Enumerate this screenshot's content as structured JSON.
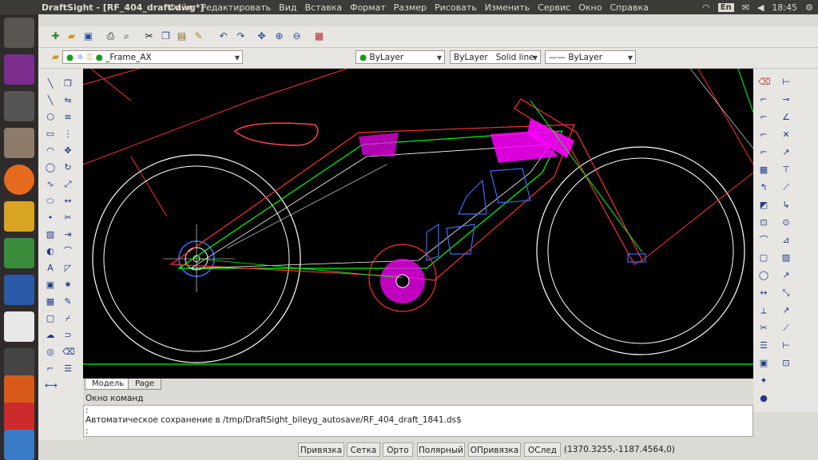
{
  "window": {
    "title": "DraftSight - [RF_404_draft.dwg*]"
  },
  "menu": [
    "Файл",
    "Редактировать",
    "Вид",
    "Вставка",
    "Формат",
    "Размер",
    "Рисовать",
    "Изменить",
    "Сервис",
    "Окно",
    "Справка"
  ],
  "system": {
    "language": "En",
    "time": "18:45"
  },
  "layer_toolbar": {
    "layer_name": "_Frame_AX",
    "color": "ByLayer",
    "linetype_label": "ByLayer",
    "linetype_value": "Solid line",
    "lineweight": "ByLayer"
  },
  "tabs": [
    "Модель",
    "Page"
  ],
  "command_window": {
    "title": "Окно команд",
    "lines": [
      ":",
      "Автоматическое сохранение в /tmp/DraftSight_bileyg_autosave/RF_404_draft_1841.ds$",
      ":"
    ]
  },
  "status_bar": {
    "buttons": [
      "Привязка",
      "Сетка",
      "Орто",
      "Полярный",
      "ОПривязка",
      "ОСлед"
    ],
    "coordinates": "(1370.3255,-1187.4564,0)"
  },
  "colors": {
    "canvas": "#000000",
    "panel": "#3c3b37",
    "launcher": "#2f2b2a",
    "accent_magenta": "#ff00ff",
    "line_green": "#00ff00",
    "line_red": "#ff2020"
  }
}
